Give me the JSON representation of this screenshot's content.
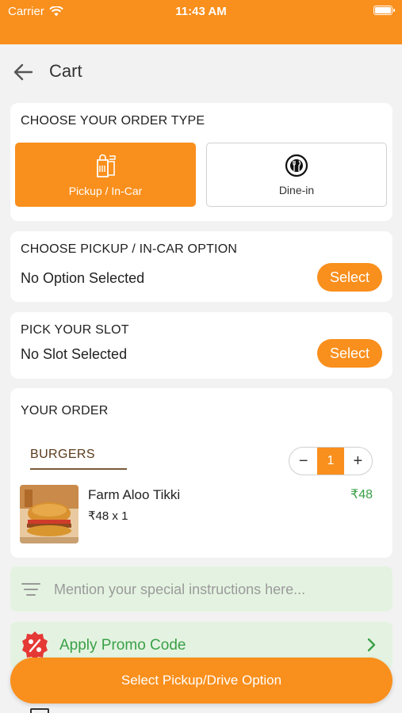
{
  "status_bar": {
    "carrier": "Carrier",
    "time": "11:43 AM"
  },
  "nav": {
    "title": "Cart"
  },
  "order_type": {
    "heading": "CHOOSE YOUR ORDER TYPE",
    "options": [
      {
        "label": "Pickup / In-Car",
        "icon": "pickup-bag-icon",
        "selected": true
      },
      {
        "label": "Dine-in",
        "icon": "dine-in-icon",
        "selected": false
      }
    ]
  },
  "pickup_option": {
    "heading": "CHOOSE PICKUP / IN-CAR OPTION",
    "value": "No Option Selected",
    "button": "Select"
  },
  "slot": {
    "heading": "PICK YOUR SLOT",
    "value": "No Slot Selected",
    "button": "Select"
  },
  "order": {
    "heading": "YOUR ORDER",
    "category": "BURGERS",
    "stepper": {
      "minus": "−",
      "quantity": "1",
      "plus": "+"
    },
    "items": [
      {
        "name": "Farm Aloo Tikki",
        "unit_line": "₹48 x 1",
        "price": "₹48"
      }
    ]
  },
  "instructions": {
    "placeholder": "Mention your special instructions here..."
  },
  "promo": {
    "label": "Apply Promo Code"
  },
  "cta": {
    "label": "Select Pickup/Drive Option"
  },
  "colors": {
    "accent": "#f98f1c",
    "green": "#3aa048",
    "green_bg": "#e4f3e1",
    "promo_red": "#e53935"
  }
}
